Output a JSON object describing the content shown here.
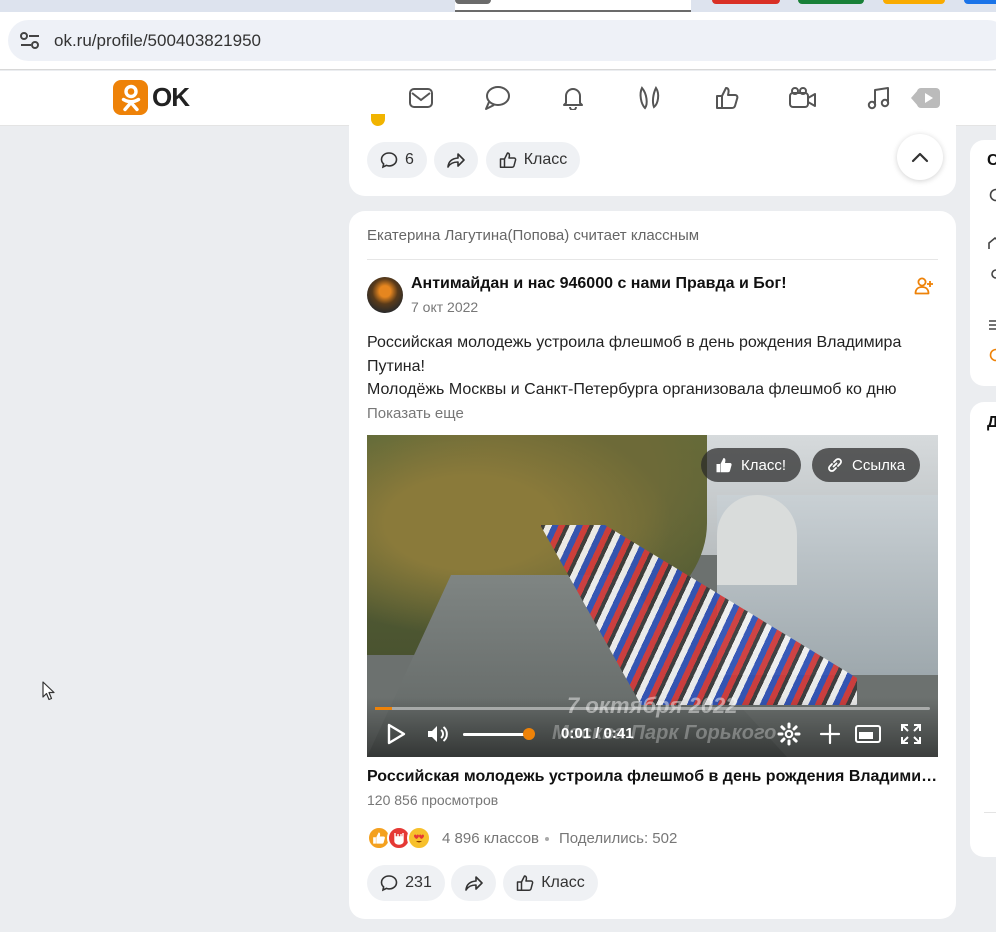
{
  "browser": {
    "url": "ok.ru/profile/500403821950"
  },
  "header": {
    "logo_text": "OK",
    "nav_icons": [
      "mail-icon",
      "chat-icon",
      "bell-icon",
      "guests-icon",
      "like-icon",
      "video-icon",
      "music-icon",
      "games-icon"
    ]
  },
  "top_post": {
    "comments_count": "6",
    "like_label": "Класс"
  },
  "main_post": {
    "liked_by": "Екатерина Лагутина(Попова) считает классным",
    "group_name": "Антимайдан и нас 946000 с нами Правда и Бог!",
    "date": "7 окт 2022",
    "text_line1": "Российская молодежь устроила флешмоб в день рождения Владимира Путина!",
    "text_line2": "Молодёжь Москвы и Санкт-Петербурга организовала флешмоб ко дню",
    "show_more": "Показать еще",
    "video": {
      "class_button": "Класс!",
      "link_button": "Ссылка",
      "overlay_date": "7 октября 2022",
      "overlay_place": "Москва Парк Горького",
      "time": "0:01 / 0:41",
      "progress": 0.03,
      "volume": 1.0
    },
    "video_title": "Российская молодежь устроила флешмоб в день рождения Владимира Путина!",
    "views": "120 856 просмотров",
    "likes": "4 896 классов",
    "shares": "Поделились: 502",
    "comments_count": "231",
    "like_label": "Класс"
  },
  "right_column": {
    "card1_letter": "С",
    "card2_letter": "Д"
  },
  "colors": {
    "accent": "#ee8208",
    "page_bg": "#ebedf0",
    "pill_bg": "#eff1f4"
  }
}
